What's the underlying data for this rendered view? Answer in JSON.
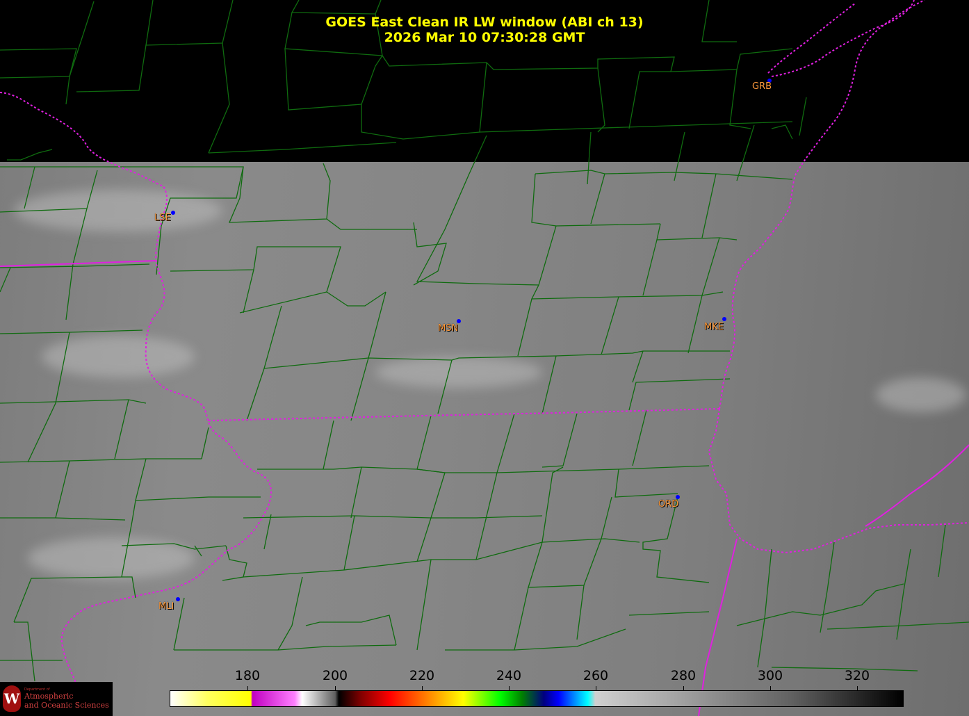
{
  "header": {
    "title_line1": "GOES East Clean IR LW window (ABI ch 13)",
    "title_line2": "2026 Mar 10  07:30:28 GMT"
  },
  "stations": [
    {
      "label": "LSE"
    },
    {
      "label": "MSN"
    },
    {
      "label": "MKE"
    },
    {
      "label": "GRB"
    },
    {
      "label": "ORD"
    },
    {
      "label": "MLI"
    }
  ],
  "colorbar": {
    "ticks": [
      "180",
      "200",
      "220",
      "240",
      "260",
      "280",
      "300",
      "320"
    ]
  },
  "logo": {
    "seal_letter": "W",
    "dept_small": "Department of",
    "line1": "Atmospheric",
    "line2": "and Oceanic Sciences"
  },
  "colors": {
    "county_lines": "#0f6b0f",
    "state_lines": "#e020e0",
    "title": "#ffff00",
    "station_label": "#ff9a3c",
    "station_dot": "#0000ff"
  }
}
